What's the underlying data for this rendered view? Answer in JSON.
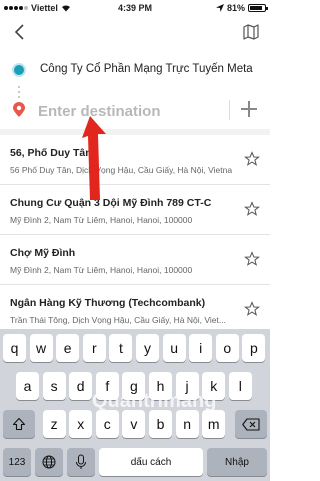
{
  "status_bar": {
    "carrier": "Viettel",
    "time": "4:39 PM",
    "battery": "81%"
  },
  "origin": {
    "text": "Công Ty Cổ Phần Mạng Trực Tuyến Meta"
  },
  "destination": {
    "placeholder": "Enter destination"
  },
  "suggestions": [
    {
      "title": "56, Phố Duy Tân",
      "subtitle": "56 Phố Duy Tân, Dịch Vọng Hậu, Cầu Giấy, Hà Nội, Vietnam"
    },
    {
      "title": "Chung Cư Quận 3 Dội Mỹ Đình 789 CT-C",
      "subtitle": "Mỹ Đình 2, Nam Từ Liêm, Hanoi, Hanoi, 100000"
    },
    {
      "title": "Chợ Mỹ Đình",
      "subtitle": "Mỹ Đình 2, Nam Từ Liêm, Hanoi, Hanoi, 100000"
    },
    {
      "title": "Ngân Hàng Kỹ Thương (Techcombank)",
      "subtitle": "Trần Thái Tông, Dịch Vọng Hậu, Cầu Giấy, Hà Nội, Viet..."
    }
  ],
  "keyboard": {
    "row1": [
      "q",
      "w",
      "e",
      "r",
      "t",
      "y",
      "u",
      "i",
      "o",
      "p"
    ],
    "row2": [
      "a",
      "s",
      "d",
      "f",
      "g",
      "h",
      "j",
      "k",
      "l"
    ],
    "row3": [
      "z",
      "x",
      "c",
      "v",
      "b",
      "n",
      "m"
    ],
    "numbers_key": "123",
    "space_label": "dấu cách",
    "return_label": "Nhập"
  },
  "watermark": "Quantrimang",
  "colors": {
    "origin_dot": "#19a0b8",
    "pin": "#e8574c",
    "arrow": "#e2261d"
  }
}
